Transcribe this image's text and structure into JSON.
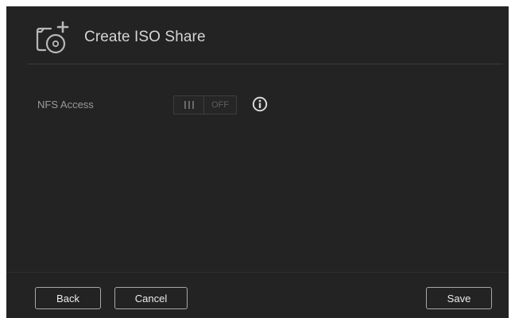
{
  "dialog": {
    "title": "Create ISO Share",
    "icon": "disc-share-add-icon"
  },
  "fields": {
    "nfs_access": {
      "label": "NFS Access",
      "toggle_state": "OFF",
      "info_icon": "info-icon"
    }
  },
  "footer": {
    "back_label": "Back",
    "cancel_label": "Cancel",
    "save_label": "Save"
  },
  "colors": {
    "background": "#232323",
    "title_text": "#d4d4d4",
    "label_text": "#9a9a9a",
    "button_border": "#a8a8a8"
  }
}
